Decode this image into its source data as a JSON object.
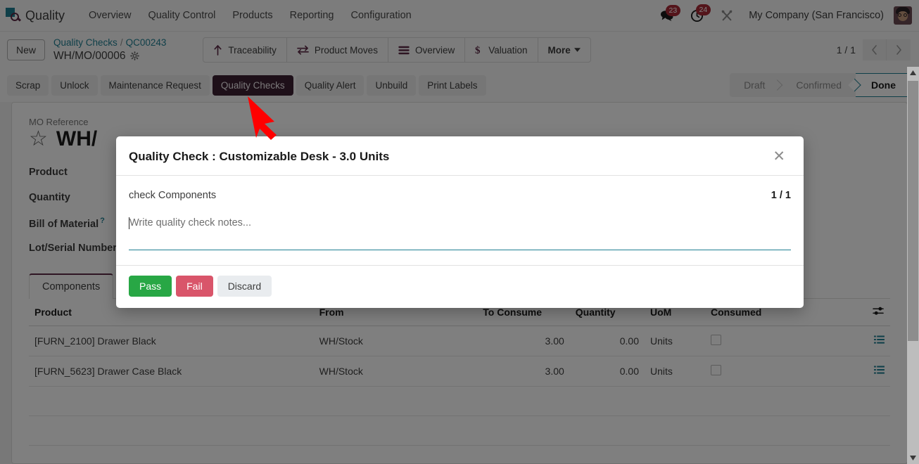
{
  "navbar": {
    "app_logo_icon": "quality-app-logo-icon",
    "app_name": "Quality",
    "menu": [
      {
        "label": "Overview"
      },
      {
        "label": "Quality Control"
      },
      {
        "label": "Products"
      },
      {
        "label": "Reporting"
      },
      {
        "label": "Configuration"
      }
    ],
    "messages_icon": "chat-bubble-icon",
    "messages_count": "23",
    "activities_icon": "clock-icon",
    "activities_count": "24",
    "debug_icon": "wrench-screwdriver-icon",
    "company": "My Company (San Francisco)",
    "avatar_icon": "user-avatar"
  },
  "control_panel": {
    "new_button": "New",
    "breadcrumb_root": "Quality Checks",
    "breadcrumb_separator": "/",
    "breadcrumb_current": "QC00243",
    "record_subtitle": "WH/MO/00006",
    "settings_icon": "gear-icon",
    "smart_buttons": [
      {
        "label": "Traceability",
        "icon": "up-arrow-icon"
      },
      {
        "label": "Product Moves",
        "icon": "exchange-arrows-icon"
      },
      {
        "label": "Overview",
        "icon": "list-lines-icon"
      },
      {
        "label": "Valuation",
        "icon": "dollar-sign-icon"
      },
      {
        "label": "More",
        "icon": "caret-down-icon"
      }
    ],
    "pager_count": "1 / 1",
    "pager_prev_icon": "chevron-left-icon",
    "pager_next_icon": "chevron-right-icon"
  },
  "action_bar": {
    "buttons": [
      {
        "label": "Scrap",
        "active": false
      },
      {
        "label": "Unlock",
        "active": false
      },
      {
        "label": "Maintenance Request",
        "active": false
      },
      {
        "label": "Quality Checks",
        "active": true
      },
      {
        "label": "Quality Alert",
        "active": false
      },
      {
        "label": "Unbuild",
        "active": false
      },
      {
        "label": "Print Labels",
        "active": false
      }
    ],
    "stages": [
      {
        "label": "Draft",
        "active": false
      },
      {
        "label": "Confirmed",
        "active": false
      },
      {
        "label": "Done",
        "active": true
      }
    ]
  },
  "form": {
    "mo_reference_label": "MO Reference",
    "favorite_icon": "star-icon",
    "record_title": "WH/",
    "fields": [
      {
        "label": "Product",
        "help": false
      },
      {
        "label": "Quantity",
        "help": false
      },
      {
        "label": "Bill of Material",
        "help": true
      },
      {
        "label": "Lot/Serial Number",
        "help": false
      }
    ],
    "help_marker": "?",
    "tabs": [
      {
        "label": "Components",
        "active": true
      }
    ]
  },
  "lines_table": {
    "columns": [
      "Product",
      "From",
      "To Consume",
      "Quantity",
      "UoM",
      "Consumed"
    ],
    "optional_columns_icon": "settings-sliders-icon",
    "rows": [
      {
        "product": "[FURN_2100] Drawer Black",
        "from": "WH/Stock",
        "to_consume": "3.00",
        "quantity": "0.00",
        "uom": "Units",
        "consumed": false,
        "row_menu_icon": "list-icon"
      },
      {
        "product": "[FURN_5623] Drawer Case Black",
        "from": "WH/Stock",
        "to_consume": "3.00",
        "quantity": "0.00",
        "uom": "Units",
        "consumed": false,
        "row_menu_icon": "list-icon"
      }
    ]
  },
  "modal": {
    "title": "Quality Check : Customizable Desk - 3.0 Units",
    "close_icon": "close-icon",
    "check_name": "check Components",
    "check_pager": "1 / 1",
    "notes_placeholder": "Write quality check notes...",
    "notes_value": "",
    "buttons": [
      {
        "label": "Pass",
        "style": "pass"
      },
      {
        "label": "Fail",
        "style": "fail"
      },
      {
        "label": "Discard",
        "style": "discard"
      }
    ]
  },
  "scrollbar": {
    "up_icon": "triangle-up-icon",
    "down_icon": "triangle-down-icon"
  },
  "annotation": {
    "arrow_icon": "red-pointer-arrow",
    "color": "#ff0000"
  },
  "colors": {
    "accent": "#1f7f92",
    "brand_dark": "#5c2a46",
    "pass": "#28a745",
    "fail": "#d9556a",
    "badge": "#a82a37"
  }
}
